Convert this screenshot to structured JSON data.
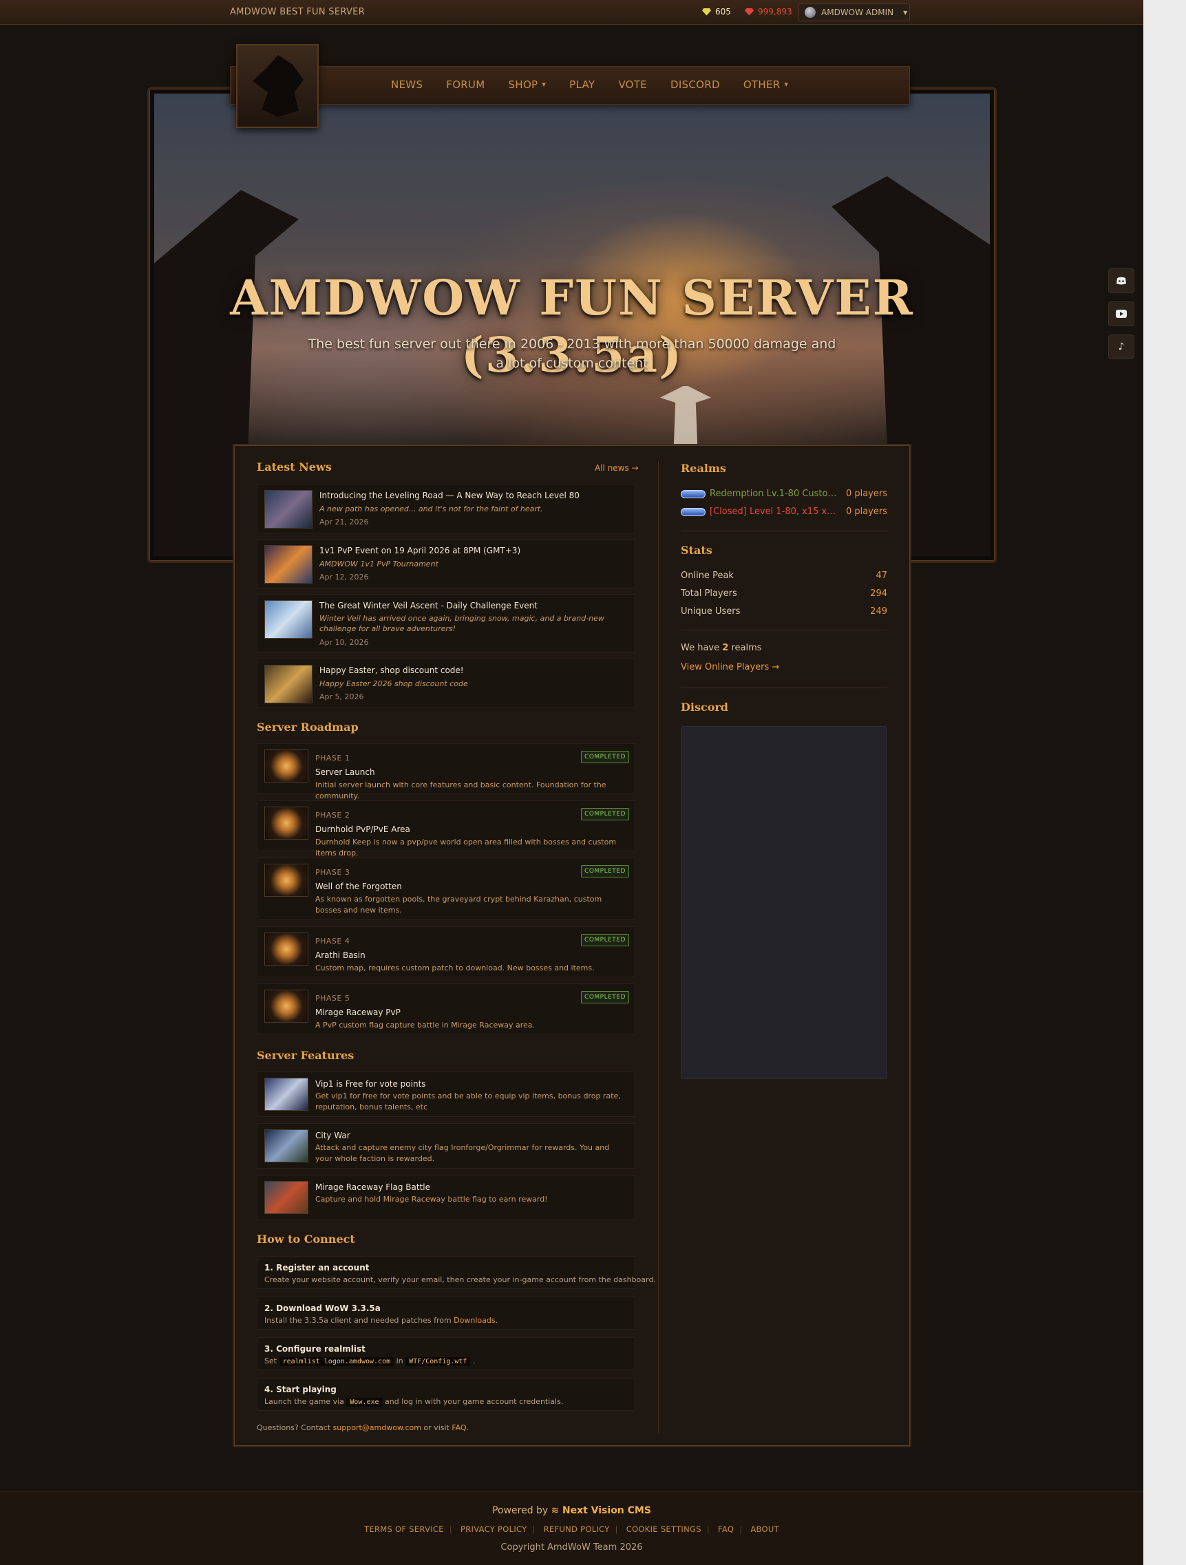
{
  "topbar": {
    "brand": "AMDWOW BEST FUN SERVER",
    "currency1": "605",
    "currency2": "999,893",
    "username": "AMDWOW ADMIN"
  },
  "nav": {
    "items": [
      "NEWS",
      "FORUM",
      "SHOP",
      "PLAY",
      "VOTE",
      "DISCORD",
      "OTHER"
    ]
  },
  "hero": {
    "title": "AMDWOW FUN SERVER (3.3.5a)",
    "subtitle": "The best fun server out there in 2006 - 2013 with more than 50000 damage and a lot of custom content"
  },
  "news": {
    "title": "Latest News",
    "all_link": "All news →",
    "items": [
      {
        "title": "Introducing the Leveling Road — A New Way to Reach Level 80",
        "subtitle": "A new path has opened... and it's not for the faint of heart.",
        "date": "Apr 21, 2026"
      },
      {
        "title": "1v1 PvP Event on 19 April 2026 at 8PM (GMT+3)",
        "subtitle": "AMDWOW 1v1 PvP Tournament",
        "date": "Apr 12, 2026"
      },
      {
        "title": "The Great Winter Veil Ascent - Daily Challenge Event",
        "subtitle": "Winter Veil has arrived once again, bringing snow, magic, and a brand-new challenge for all brave adventurers!",
        "date": "Apr 10, 2026"
      },
      {
        "title": "Happy Easter, shop discount code!",
        "subtitle": "Happy Easter 2026 shop discount code",
        "date": "Apr 5, 2026"
      }
    ]
  },
  "roadmap": {
    "title": "Server Roadmap",
    "items": [
      {
        "phase": "PHASE 1",
        "status": "COMPLETED",
        "title": "Server Launch",
        "desc": "Initial server launch with core features and basic content. Foundation for the community."
      },
      {
        "phase": "PHASE 2",
        "status": "COMPLETED",
        "title": "Durnhold PvP/PvE Area",
        "desc": "Durnhold Keep is now a pvp/pve world open area filled with bosses and custom items drop."
      },
      {
        "phase": "PHASE 3",
        "status": "COMPLETED",
        "title": "Well of the Forgotten",
        "desc": "As known as forgotten pools, the graveyard crypt behind Karazhan, custom bosses and new items."
      },
      {
        "phase": "PHASE 4",
        "status": "COMPLETED",
        "title": "Arathi Basin",
        "desc": "Custom map, requires custom patch to download. New bosses and items."
      },
      {
        "phase": "PHASE 5",
        "status": "COMPLETED",
        "title": "Mirage Raceway PvP",
        "desc": "A PvP custom flag capture battle in Mirage Raceway area."
      }
    ]
  },
  "features": {
    "title": "Server Features",
    "items": [
      {
        "title": "Vip1 is Free for vote points",
        "desc": "Get vip1 for free for vote points and be able to equip vip items, bonus drop rate, reputation, bonus talents, etc"
      },
      {
        "title": "City War",
        "desc": "Attack and capture enemy city flag Ironforge/Orgrimmar for rewards. You and your whole faction is rewarded."
      },
      {
        "title": "Mirage Raceway Flag Battle",
        "desc": "Capture and hold Mirage Raceway battle flag to earn reward!"
      }
    ]
  },
  "connect": {
    "title": "How to Connect",
    "step1_title": "1. Register an account",
    "step1_desc": "Create your website account, verify your email, then create your in-game account from the dashboard.",
    "step2_title": "2. Download WoW 3.3.5a",
    "step2_desc_pre": "Install the 3.3.5a client and needed patches from ",
    "step2_link": "Downloads",
    "step2_desc_post": ".",
    "step3_title": "3. Configure realmlist",
    "step3_set": "Set",
    "step3_code1": "realmlist logon.amdwow.com",
    "step3_in": "in",
    "step3_code2": "WTF/Config.wtf",
    "step3_end": ".",
    "step4_title": "4. Start playing",
    "step4_pre": "Launch the game via",
    "step4_code": "Wow.exe",
    "step4_post": "and log in with your game account credentials.",
    "foot_pre": "Questions? Contact ",
    "foot_email": "support@amdwow.com",
    "foot_mid": " or visit ",
    "foot_faq": "FAQ",
    "foot_end": "."
  },
  "realms": {
    "title": "Realms",
    "items": [
      {
        "name": "Redemption Lv.1-80 Custom ...",
        "players": "0 players",
        "color": "#7fa03a"
      },
      {
        "name": "[Closed] Level 1-80, x15 xp ...",
        "players": "0 players",
        "color": "#e04a3a"
      }
    ]
  },
  "stats": {
    "title": "Stats",
    "rows": [
      {
        "label": "Online Peak",
        "value": "47"
      },
      {
        "label": "Total Players",
        "value": "294"
      },
      {
        "label": "Unique Users",
        "value": "249"
      }
    ],
    "realms_pre": "We have ",
    "realms_count": "2",
    "realms_post": " realms",
    "view_online": "View Online Players →"
  },
  "discord": {
    "title": "Discord"
  },
  "footer": {
    "powered_pre": "Powered by",
    "cms": "Next Vision CMS",
    "links": [
      "TERMS OF SERVICE",
      "PRIVACY POLICY",
      "REFUND POLICY",
      "COOKIE SETTINGS",
      "FAQ",
      "ABOUT"
    ],
    "copyright": "Copyright AmdWoW Team 2026"
  },
  "icons": {
    "social": [
      "discord-icon",
      "youtube-icon",
      "tiktok-icon"
    ]
  }
}
